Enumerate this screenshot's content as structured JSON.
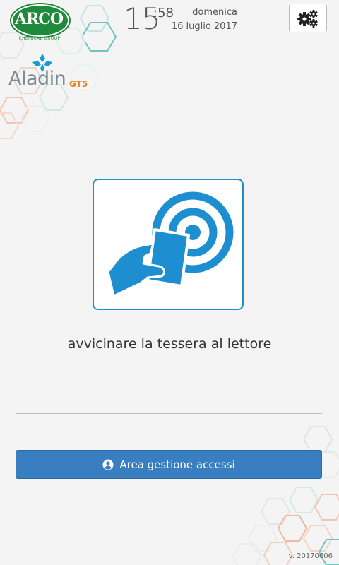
{
  "brand": {
    "arco_name": "ARCO",
    "arco_sub": "CHEMICAL GROUP",
    "product": "Aladin",
    "product_suffix": "GT5"
  },
  "clock": {
    "hours": "15",
    "minutes": ":58",
    "weekday": "domenica",
    "date": "16 luglio 2017"
  },
  "settings": {
    "icon": "gears-icon"
  },
  "reader": {
    "icon": "nfc-card-tap-icon",
    "instruction": "avvicinare la tessera al lettore"
  },
  "access_button": {
    "icon": "user-circle-icon",
    "label": "Area gestione accessi"
  },
  "version": "v. 20170606",
  "colors": {
    "accent": "#1d8fd0",
    "button": "#3a7ec2",
    "arco_green": "#1f8a3b",
    "gt5_orange": "#e67e22",
    "hex_teal": "#6cc5c0",
    "hex_orange": "#f2b8a2"
  }
}
